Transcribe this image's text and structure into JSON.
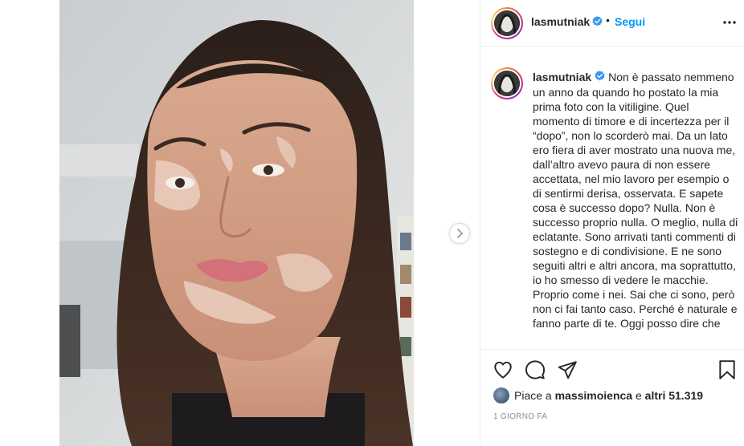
{
  "post": {
    "username": "lasmutniak",
    "follow_separator": "•",
    "follow_label": "Segui",
    "caption": "Non è passato nemmeno un anno da quando ho postato la mia prima foto con la vitiligine. Quel momento di timore e di incertezza per il “dopo”, non lo scorderò mai. Da un lato ero fiera di aver mostrato una nuova me, dall’altro avevo paura di non essere accettata, nel mio lavoro per esempio o di sentirmi derisa, osservata. E sapete cosa è successo dopo? Nulla. Non è successo proprio nulla. O meglio, nulla di eclatante. Sono arrivati tanti commenti di sostegno e di condivisione. E ne sono seguiti altri e altri ancora, ma soprattutto, io ho smesso di vedere le macchie. Proprio come i nei. Sai che ci sono, però non ci fai tanto caso. Perché è naturale e fanno parte di te. Oggi posso dire che",
    "likes_prefix": "Piace a",
    "likes_user": "massimoienca",
    "likes_middle": "e",
    "likes_count": "altri 51.319",
    "timestamp": "1 GIORNO FA"
  },
  "icons": {
    "verified": "verified-badge-icon",
    "more": "more-options-icon",
    "like": "heart-icon",
    "comment": "comment-icon",
    "share": "send-icon",
    "save": "bookmark-icon",
    "next": "chevron-right-icon"
  },
  "colors": {
    "accent": "#0095f6",
    "text": "#262626",
    "muted": "#8e8e8e",
    "border": "#efefef"
  }
}
